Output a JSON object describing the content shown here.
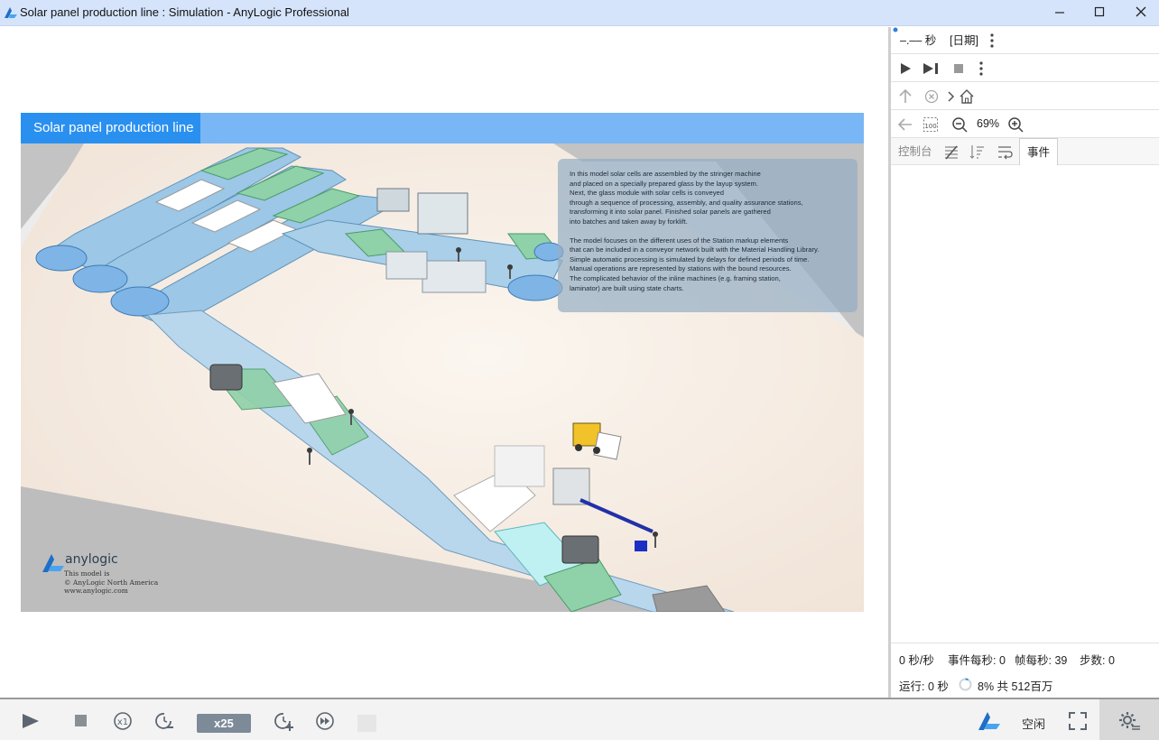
{
  "window": {
    "title": "Solar panel production line : Simulation - AnyLogic Professional"
  },
  "model": {
    "title": "Solar panel production line",
    "description_p1": "In this model solar cells are assembled by the stringer machine\nand placed on a specially prepared glass by the layup system.\nNext, the glass module with solar cells is conveyed\nthrough a sequence of processing, assembly, and quality assurance stations,\ntransforming it into solar panel. Finished solar panels are gathered\ninto batches and taken away by forklift.",
    "description_p2": "The model focuses on the different uses of the Station markup elements\nthat can be included in a conveyor network built with the Material Handling Library.\nSimple automatic processing is simulated by delays for defined periods of time.\nManual operations are represented by stations with the bound resources.\nThe complicated behavior of the inline machines (e.g. framing station,\nlaminator) are built using state charts.",
    "logo_brand": "anylogic",
    "logo_credit": "This model is\n© AnyLogic North America\nwww.anylogic.com"
  },
  "panel": {
    "time_value": "–.–– 秒",
    "date_label": "[日期]",
    "zoom_level": "69%",
    "tabs": [
      {
        "label": "控制台"
      },
      {
        "label": "事件"
      }
    ],
    "stats": {
      "per_sec": "0 秒/秒",
      "events_per_sec": "事件每秒: 0",
      "frames_per_sec": "帧每秒: 39",
      "steps": "步数: 0",
      "run_time": "运行: 0 秒",
      "memory": "8% 共 512百万"
    }
  },
  "toolbar": {
    "speed_label": "x25",
    "status": "空闲"
  },
  "colors": {
    "titlebar": "#d5e4fb",
    "model_header": "#79b6f5",
    "model_title_bg": "#2a90f0",
    "accent_blue": "#3a8dde"
  }
}
